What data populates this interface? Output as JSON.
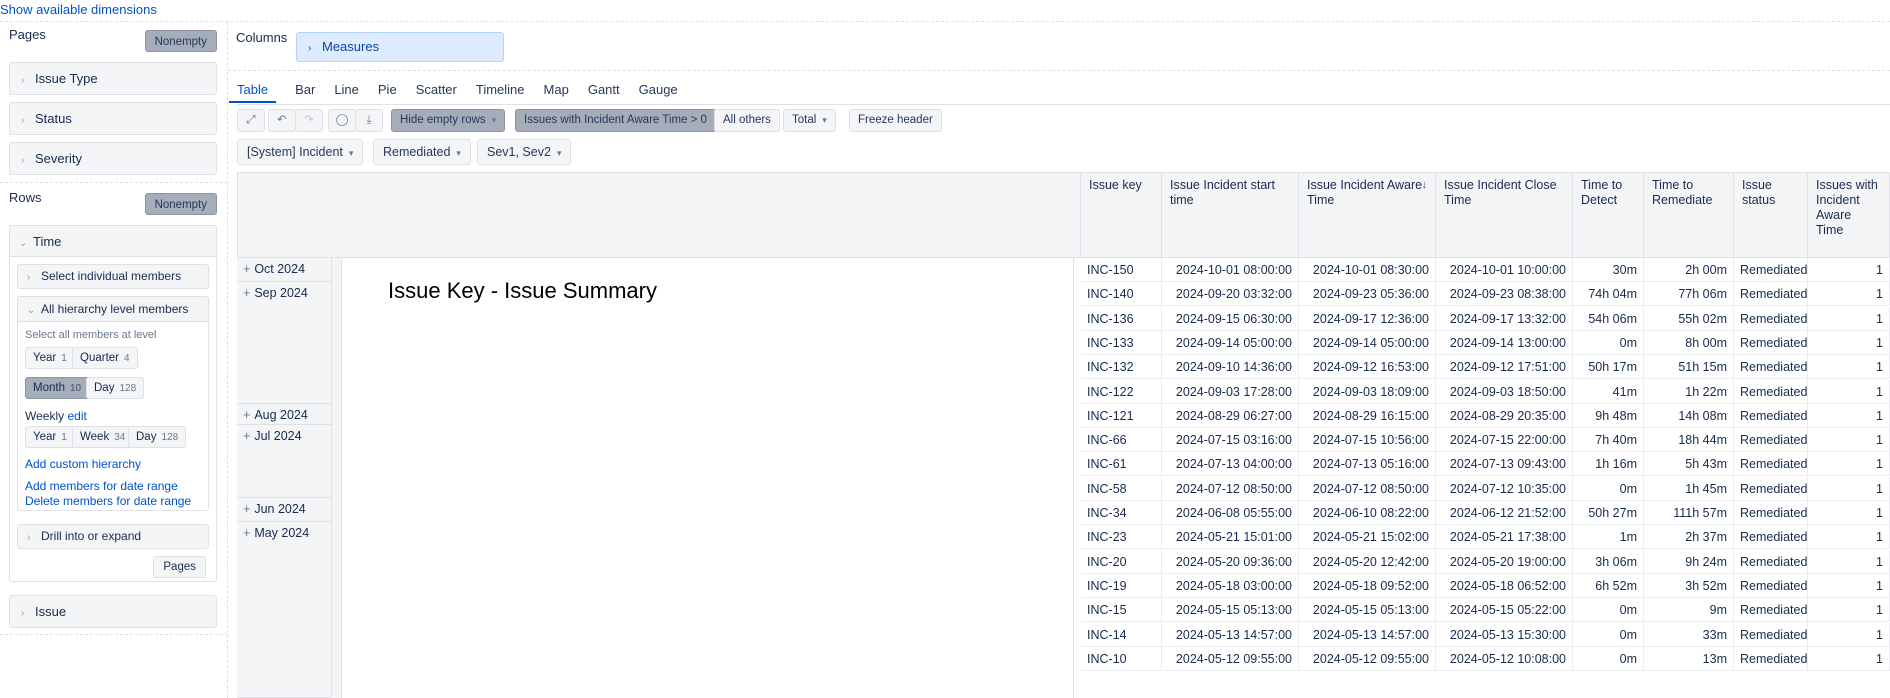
{
  "top_link": "Show available dimensions",
  "pages": {
    "title": "Pages",
    "nonempty_label": "Nonempty",
    "dimensions": [
      "Issue Type",
      "Status",
      "Severity"
    ]
  },
  "rows": {
    "title": "Rows",
    "nonempty_label": "Nonempty",
    "time": {
      "label": "Time",
      "select_individual": "Select individual members",
      "all_levels": "All hierarchy level members",
      "select_all_note": "Select all members at level",
      "levels": [
        {
          "name": "Year",
          "count": "1"
        },
        {
          "name": "Quarter",
          "count": "4"
        },
        {
          "name": "Month",
          "count": "10"
        },
        {
          "name": "Day",
          "count": "128"
        }
      ],
      "weekly_label": "Weekly",
      "weekly_edit": "edit",
      "weekly_levels": [
        {
          "name": "Year",
          "count": "1"
        },
        {
          "name": "Week",
          "count": "34"
        },
        {
          "name": "Day",
          "count": "128"
        }
      ],
      "add_custom_hierarchy": "Add custom hierarchy",
      "add_members_date_range": "Add members for date range",
      "delete_members_date_range": "Delete members for date range",
      "drill_label": "Drill into or expand",
      "pages_button": "Pages"
    },
    "issue_label": "Issue"
  },
  "columns": {
    "title": "Columns",
    "measures_label": "Measures"
  },
  "tabs": [
    "Table",
    "Bar",
    "Line",
    "Pie",
    "Scatter",
    "Timeline",
    "Map",
    "Gantt",
    "Gauge"
  ],
  "toolbar": {
    "hide_empty_rows": "Hide empty rows",
    "issues_filter": "Issues with Incident Aware Time > 0",
    "all_others": "All others",
    "total": "Total",
    "freeze_header": "Freeze header"
  },
  "filters": [
    "[System] Incident",
    "Remediated",
    "Sev1, Sev2"
  ],
  "table": {
    "headers": {
      "key": "Issue key",
      "start": "Issue Incident start time",
      "aware": "Issue Incident Aware Time",
      "close": "Issue Incident Close Time",
      "detect": "Time to Detect",
      "remediate": "Time to Remediate",
      "status": "Issue status",
      "count": "Issues with Incident Aware Time"
    },
    "summary_title": "Issue Key - Issue Summary",
    "months": [
      "Oct 2024",
      "Sep 2024",
      "Aug 2024",
      "Jul 2024",
      "Jun 2024",
      "May 2024"
    ],
    "rows": [
      {
        "key": "INC-150",
        "start": "2024-10-01 08:00:00",
        "aware": "2024-10-01 08:30:00",
        "close": "2024-10-01 10:00:00",
        "detect": "30m",
        "remediate": "2h 00m",
        "status": "Remediated",
        "count": "1"
      },
      {
        "key": "INC-140",
        "start": "2024-09-20 03:32:00",
        "aware": "2024-09-23 05:36:00",
        "close": "2024-09-23 08:38:00",
        "detect": "74h 04m",
        "remediate": "77h 06m",
        "status": "Remediated",
        "count": "1"
      },
      {
        "key": "INC-136",
        "start": "2024-09-15 06:30:00",
        "aware": "2024-09-17 12:36:00",
        "close": "2024-09-17 13:32:00",
        "detect": "54h 06m",
        "remediate": "55h 02m",
        "status": "Remediated",
        "count": "1"
      },
      {
        "key": "INC-133",
        "start": "2024-09-14 05:00:00",
        "aware": "2024-09-14 05:00:00",
        "close": "2024-09-14 13:00:00",
        "detect": "0m",
        "remediate": "8h 00m",
        "status": "Remediated",
        "count": "1"
      },
      {
        "key": "INC-132",
        "start": "2024-09-10 14:36:00",
        "aware": "2024-09-12 16:53:00",
        "close": "2024-09-12 17:51:00",
        "detect": "50h 17m",
        "remediate": "51h 15m",
        "status": "Remediated",
        "count": "1"
      },
      {
        "key": "INC-122",
        "start": "2024-09-03 17:28:00",
        "aware": "2024-09-03 18:09:00",
        "close": "2024-09-03 18:50:00",
        "detect": "41m",
        "remediate": "1h 22m",
        "status": "Remediated",
        "count": "1"
      },
      {
        "key": "INC-121",
        "start": "2024-08-29 06:27:00",
        "aware": "2024-08-29 16:15:00",
        "close": "2024-08-29 20:35:00",
        "detect": "9h 48m",
        "remediate": "14h 08m",
        "status": "Remediated",
        "count": "1"
      },
      {
        "key": "INC-66",
        "start": "2024-07-15 03:16:00",
        "aware": "2024-07-15 10:56:00",
        "close": "2024-07-15 22:00:00",
        "detect": "7h 40m",
        "remediate": "18h 44m",
        "status": "Remediated",
        "count": "1"
      },
      {
        "key": "INC-61",
        "start": "2024-07-13 04:00:00",
        "aware": "2024-07-13 05:16:00",
        "close": "2024-07-13 09:43:00",
        "detect": "1h 16m",
        "remediate": "5h 43m",
        "status": "Remediated",
        "count": "1"
      },
      {
        "key": "INC-58",
        "start": "2024-07-12 08:50:00",
        "aware": "2024-07-12 08:50:00",
        "close": "2024-07-12 10:35:00",
        "detect": "0m",
        "remediate": "1h 45m",
        "status": "Remediated",
        "count": "1"
      },
      {
        "key": "INC-34",
        "start": "2024-06-08 05:55:00",
        "aware": "2024-06-10 08:22:00",
        "close": "2024-06-12 21:52:00",
        "detect": "50h 27m",
        "remediate": "111h 57m",
        "status": "Remediated",
        "count": "1"
      },
      {
        "key": "INC-23",
        "start": "2024-05-21 15:01:00",
        "aware": "2024-05-21 15:02:00",
        "close": "2024-05-21 17:38:00",
        "detect": "1m",
        "remediate": "2h 37m",
        "status": "Remediated",
        "count": "1"
      },
      {
        "key": "INC-20",
        "start": "2024-05-20 09:36:00",
        "aware": "2024-05-20 12:42:00",
        "close": "2024-05-20 19:00:00",
        "detect": "3h 06m",
        "remediate": "9h 24m",
        "status": "Remediated",
        "count": "1"
      },
      {
        "key": "INC-19",
        "start": "2024-05-18 03:00:00",
        "aware": "2024-05-18 09:52:00",
        "close": "2024-05-18 06:52:00",
        "detect": "6h 52m",
        "remediate": "3h 52m",
        "status": "Remediated",
        "count": "1"
      },
      {
        "key": "INC-15",
        "start": "2024-05-15 05:13:00",
        "aware": "2024-05-15 05:13:00",
        "close": "2024-05-15 05:22:00",
        "detect": "0m",
        "remediate": "9m",
        "status": "Remediated",
        "count": "1"
      },
      {
        "key": "INC-14",
        "start": "2024-05-13 14:57:00",
        "aware": "2024-05-13 14:57:00",
        "close": "2024-05-13 15:30:00",
        "detect": "0m",
        "remediate": "33m",
        "status": "Remediated",
        "count": "1"
      },
      {
        "key": "INC-10",
        "start": "2024-05-12 09:55:00",
        "aware": "2024-05-12 09:55:00",
        "close": "2024-05-12 10:08:00",
        "detect": "0m",
        "remediate": "13m",
        "status": "Remediated",
        "count": "1"
      }
    ]
  }
}
